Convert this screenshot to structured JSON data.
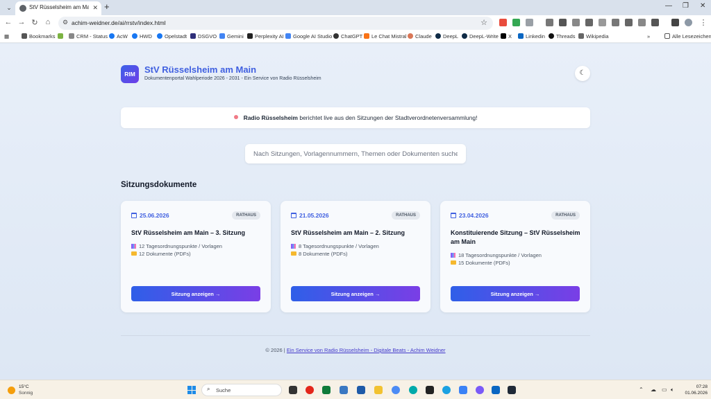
{
  "browser": {
    "tab_title": "StV Rüsselsheim am Main - Doku",
    "url": "achim-weidner.de/ai/rrstv/index.html",
    "bookmarks": [
      "Bookmarks",
      "CRM - Status",
      "AcW",
      "HWD",
      "Opelstadt",
      "DSGVO",
      "Gemini",
      "Perplexity AI",
      "Google AI Studio",
      "ChatGPT",
      "Le Chat Mistral",
      "Claude",
      "DeepL",
      "DeepL-Write",
      "X",
      "Linkedin",
      "Threads",
      "Wikipedia"
    ],
    "all_bookmarks": "Alle Lesezeichen"
  },
  "header": {
    "logo": "RIM",
    "title": "StV Rüsselsheim am Main",
    "subtitle": "Dokumentenportal Wahlperiode 2026 - 2031 - Ein Service von Radio Rüsselsheim",
    "theme_icon": "moon-icon"
  },
  "banner": {
    "brand": "Radio Rüsselsheim",
    "text": " berichtet live aus den Sitzungen der Stadtverordnetenversammlung!"
  },
  "search": {
    "placeholder": "Nach Sitzungen, Vorlagennummern, Themen oder Dokumenten suchen"
  },
  "section_title": "Sitzungsdokumente",
  "cards": [
    {
      "date": "25.06.2026",
      "badge": "RATHAUS",
      "title": "StV Rüsselsheim am Main – 3. Sitzung",
      "items": "12 Tagesordnungspunkte / Vorlagen",
      "docs": "12 Dokumente (PDFs)",
      "button": "Sitzung anzeigen →"
    },
    {
      "date": "21.05.2026",
      "badge": "RATHAUS",
      "title": "StV Rüsselsheim am Main – 2. Sitzung",
      "items": "8 Tagesordnungspunkte / Vorlagen",
      "docs": "8 Dokumente (PDFs)",
      "button": "Sitzung anzeigen →"
    },
    {
      "date": "23.04.2026",
      "badge": "RATHAUS",
      "title": "Konstituierende Sitzung – StV Rüsselsheim am Main",
      "items": "18 Tagesordnungspunkte / Vorlagen",
      "docs": "15 Dokumente (PDFs)",
      "button": "Sitzung anzeigen →"
    }
  ],
  "footer": {
    "prefix": "© 2026 | ",
    "link": "Ein Service von Radio Rüsselsheim - Digitale Beats - Achim Weidner"
  },
  "taskbar": {
    "temperature": "15°C",
    "weather": "Sonnig",
    "search_label": "Suche",
    "time": "07:28",
    "date": "01.06.2026"
  }
}
